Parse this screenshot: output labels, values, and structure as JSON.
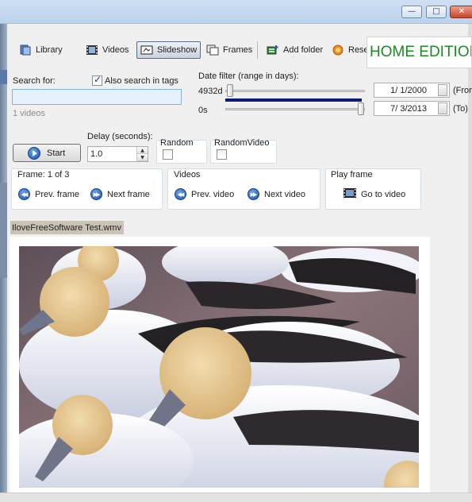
{
  "window": {
    "minimize_icon": "minimize-icon",
    "maximize_icon": "maximize-icon",
    "close_icon": "close-icon"
  },
  "toolbar": {
    "library": "Library",
    "videos": "Videos",
    "slideshow": "Slideshow",
    "frames": "Frames",
    "add_folder": "Add folder",
    "reset": "Reset",
    "active_tab": "Slideshow"
  },
  "banner": "HOME EDITION",
  "search": {
    "label": "Search for:",
    "also_search_tags": "Also search in tags",
    "also_search_tags_checked": true,
    "value": "",
    "count": "1 videos"
  },
  "date_filter": {
    "label": "Date filter (range in days):",
    "upper_value": "4932d",
    "lower_value": "0s",
    "from_date": "1/  1/2000",
    "to_date": "7/  3/2013",
    "from_label": "(From",
    "to_label": "(To)"
  },
  "slideshow": {
    "start": "Start",
    "delay_label": "Delay (seconds):",
    "delay_value": "1.0",
    "random_label": "Random",
    "random_checked": false,
    "random_video_label": "RandomVideo",
    "random_video_checked": false
  },
  "frame_group": {
    "title": "Frame: 1 of 3",
    "prev": "Prev. frame",
    "next": "Next frame"
  },
  "videos_group": {
    "title": "Videos",
    "prev": "Prev. video",
    "next": "Next video"
  },
  "play_group": {
    "title": "Play frame",
    "go": "Go to video"
  },
  "current_file": "IloveFreeSoftware Test.wmv",
  "colors": {
    "banner_text": "#1d8a26",
    "range_bar": "#0b1a7a",
    "search_bg": "#e6f1fb",
    "file_label_bg": "#c9c4b6"
  }
}
